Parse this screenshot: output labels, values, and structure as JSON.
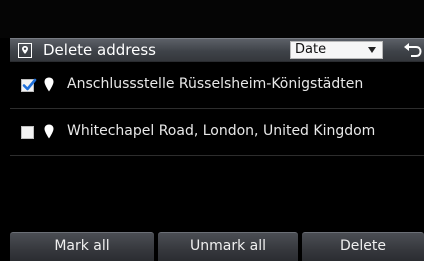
{
  "header": {
    "title": "Delete address",
    "sort": {
      "selected": "Date"
    }
  },
  "list": {
    "items": [
      {
        "label": "Anschlussstelle Rüsselsheim-Königstädten",
        "checked": true
      },
      {
        "label": "Whitechapel Road, London, United Kingdom",
        "checked": false
      }
    ]
  },
  "footer": {
    "mark_all_label": "Mark all",
    "unmark_all_label": "Unmark all",
    "delete_label": "Delete"
  },
  "icons": {
    "header": "address-book-icon",
    "back": "back-arrow-icon",
    "item": "location-pin-icon",
    "check": "checkmark-icon"
  },
  "colors": {
    "checkmark": "#1e6fd9",
    "background": "#000000",
    "header": "#4a4e55"
  }
}
